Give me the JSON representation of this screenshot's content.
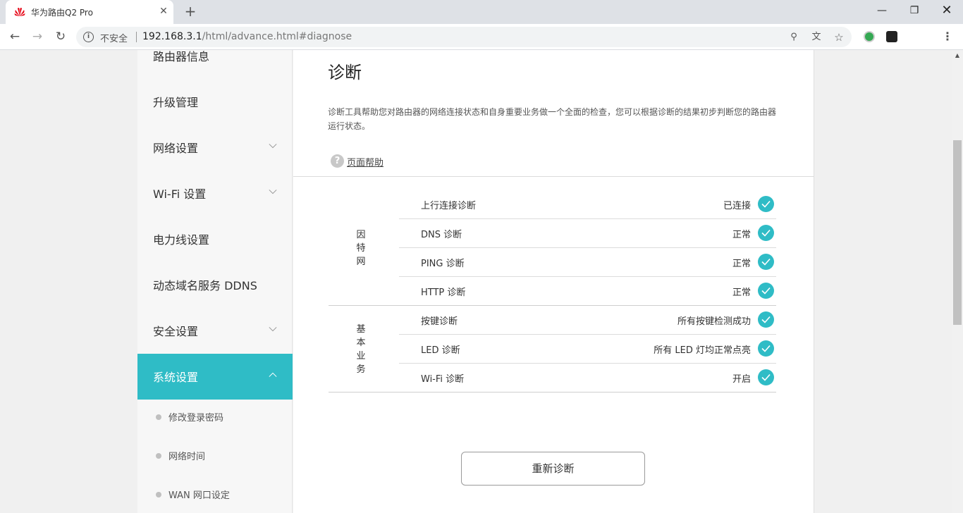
{
  "browser": {
    "tab_title": "华为路由Q2 Pro",
    "tab_close": "✕",
    "new_tab": "+",
    "insecure_label": "不安全",
    "url_host": "192.168.3.1",
    "url_path": "/html/advance.html#diagnose"
  },
  "sidebar": {
    "items": [
      {
        "label": "路由器信息",
        "expandable": false
      },
      {
        "label": "升级管理",
        "expandable": false
      },
      {
        "label": "网络设置",
        "expandable": true
      },
      {
        "label": "Wi-Fi 设置",
        "expandable": true
      },
      {
        "label": "电力线设置",
        "expandable": false
      },
      {
        "label": "动态域名服务 DDNS",
        "expandable": false
      },
      {
        "label": "安全设置",
        "expandable": true
      },
      {
        "label": "系统设置",
        "expandable": true,
        "active": true
      }
    ],
    "subitems": [
      "修改登录密码",
      "网络时间",
      "WAN 网口设定"
    ]
  },
  "main": {
    "title": "诊断",
    "description": "诊断工具帮助您对路由器的网络连接状态和自身重要业务做一个全面的检查，您可以根据诊断的结果初步判断您的路由器运行状态。",
    "help_label": "页面帮助",
    "groups": [
      {
        "label": [
          "因",
          "特",
          "网"
        ],
        "rows": [
          {
            "name": "上行连接诊断",
            "status": "已连接"
          },
          {
            "name": "DNS 诊断",
            "status": "正常"
          },
          {
            "name": "PING 诊断",
            "status": "正常"
          },
          {
            "name": "HTTP 诊断",
            "status": "正常"
          }
        ]
      },
      {
        "label": [
          "基",
          "本",
          "业",
          "务"
        ],
        "rows": [
          {
            "name": "按键诊断",
            "status": "所有按键检测成功"
          },
          {
            "name": "LED 诊断",
            "status": "所有 LED 灯均正常点亮"
          },
          {
            "name": "Wi-Fi 诊断",
            "status": "开启"
          }
        ]
      }
    ],
    "rediagnose_label": "重新诊断"
  },
  "colors": {
    "accent": "#2fbcc6",
    "brand_red": "#e60012"
  }
}
